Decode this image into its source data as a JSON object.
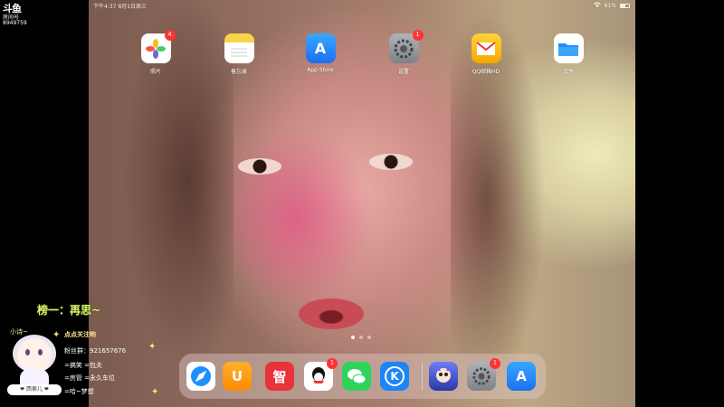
{
  "overlay": {
    "logo": "斗鱼",
    "room_label": "房间号",
    "room_id": "8949759",
    "rank_text": "榜一：再思~",
    "follow_text": "点点关注哟",
    "fan_group": "粉丝群：921657676",
    "gift_rows": [
      "=搞笑  =包夫",
      "=房管  =永久车位",
      "=哈~梦想"
    ],
    "avatar_name": "小诗~",
    "avatar_tag": "❤ 西索儿 ❤"
  },
  "statusbar": {
    "time": "下午4:37  8月1日周三",
    "battery": "61%",
    "battery_level": 0.61,
    "wifi_icon": "wifi-icon"
  },
  "home_apps": [
    {
      "label": "照片",
      "icon": "photos-icon",
      "badge": "4"
    },
    {
      "label": "备忘录",
      "icon": "notes-icon",
      "badge": ""
    },
    {
      "label": "App Store",
      "icon": "appstore-icon",
      "badge": ""
    },
    {
      "label": "设置",
      "icon": "settings-icon",
      "badge": "1"
    },
    {
      "label": "QQ邮箱HD",
      "icon": "qqmail-icon",
      "badge": ""
    },
    {
      "label": "文件",
      "icon": "files-icon",
      "badge": ""
    }
  ],
  "dock_apps": [
    {
      "icon": "safari-icon",
      "badge": ""
    },
    {
      "icon": "uc-browser-icon",
      "badge": ""
    },
    {
      "icon": "zhihu-icon",
      "badge": ""
    },
    {
      "icon": "qq-icon",
      "badge": "1"
    },
    {
      "icon": "wechat-icon",
      "badge": ""
    },
    {
      "icon": "kuwo-icon",
      "badge": ""
    },
    {
      "icon": "game-icon",
      "badge": ""
    },
    {
      "icon": "settings-icon",
      "badge": "1"
    },
    {
      "icon": "appstore-icon",
      "badge": ""
    }
  ],
  "glyphs": {
    "zhihu": "智",
    "kuwo": "K",
    "appstore": "A",
    "safari": "➚",
    "uc": "U",
    "files": "▭"
  },
  "colors": {
    "badge": "#ff3333",
    "rank_text": "#d9f56a"
  }
}
